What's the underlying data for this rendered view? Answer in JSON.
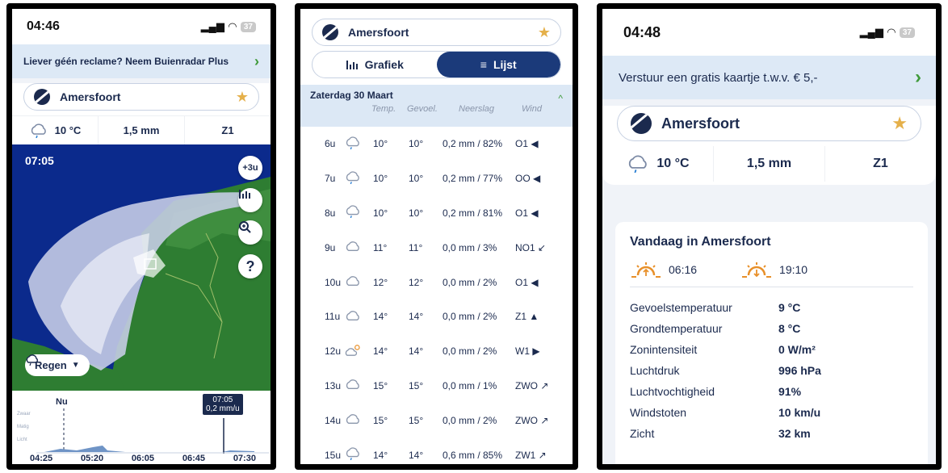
{
  "panel1": {
    "status_time": "04:46",
    "battery": "37",
    "promo_text": "Liever géén reclame? Neem Buienradar Plus",
    "location": "Amersfoort",
    "temp": "10 °C",
    "precip": "1,5 mm",
    "wind": "Z1",
    "map_time": "07:05",
    "btn_plus": "+3u",
    "btn_help": "?",
    "regen_label": "Regen",
    "tl_now": "Nu",
    "tl_tip_time": "07:05",
    "tl_tip_value": "0,2 mm/u",
    "tl_levels": [
      "Zwaar",
      "Matig",
      "Licht"
    ],
    "tl_times": [
      "04:25",
      "05:20",
      "06:05",
      "06:45",
      "07:30"
    ]
  },
  "panel2": {
    "location": "Amersfoort",
    "tab_chart": "Grafiek",
    "tab_list": "Lijst",
    "day_title": "Zaterdag 30 Maart",
    "col_temp": "Temp.",
    "col_feel": "Gevoel.",
    "col_precip": "Neerslag",
    "col_wind": "Wind",
    "rows": [
      {
        "hour": "6u",
        "temp": "10°",
        "feel": "10°",
        "precip": "0,2 mm / 82%",
        "wind": "O1 ◀",
        "icon": "rain-cloud"
      },
      {
        "hour": "7u",
        "temp": "10°",
        "feel": "10°",
        "precip": "0,2 mm / 77%",
        "wind": "OO ◀",
        "icon": "rain-cloud"
      },
      {
        "hour": "8u",
        "temp": "10°",
        "feel": "10°",
        "precip": "0,2 mm / 81%",
        "wind": "O1 ◀",
        "icon": "rain-cloud"
      },
      {
        "hour": "9u",
        "temp": "11°",
        "feel": "11°",
        "precip": "0,0 mm / 3%",
        "wind": "NO1 ↙",
        "icon": "cloud"
      },
      {
        "hour": "10u",
        "temp": "12°",
        "feel": "12°",
        "precip": "0,0 mm / 2%",
        "wind": "O1 ◀",
        "icon": "cloud"
      },
      {
        "hour": "11u",
        "temp": "14°",
        "feel": "14°",
        "precip": "0,0 mm / 2%",
        "wind": "Z1 ▲",
        "icon": "cloud"
      },
      {
        "hour": "12u",
        "temp": "14°",
        "feel": "14°",
        "precip": "0,0 mm / 2%",
        "wind": "W1 ▶",
        "icon": "sun-cloud"
      },
      {
        "hour": "13u",
        "temp": "15°",
        "feel": "15°",
        "precip": "0,0 mm / 1%",
        "wind": "ZWO ↗",
        "icon": "cloud"
      },
      {
        "hour": "14u",
        "temp": "15°",
        "feel": "15°",
        "precip": "0,0 mm / 2%",
        "wind": "ZWO ↗",
        "icon": "cloud"
      },
      {
        "hour": "15u",
        "temp": "14°",
        "feel": "14°",
        "precip": "0,6 mm / 85%",
        "wind": "ZW1 ↗",
        "icon": "rain-cloud"
      }
    ]
  },
  "panel3": {
    "status_time": "04:48",
    "battery": "37",
    "promo_text": "Verstuur een gratis kaartje t.w.v. € 5,-",
    "location": "Amersfoort",
    "temp": "10 °C",
    "precip": "1,5 mm",
    "wind": "Z1",
    "today_title": "Vandaag in Amersfoort",
    "sunrise": "06:16",
    "sunset": "19:10",
    "details": [
      {
        "label": "Gevoelstemperatuur",
        "value": "9 °C"
      },
      {
        "label": "Grondtemperatuur",
        "value": "8 °C"
      },
      {
        "label": "Zonintensiteit",
        "value": "0 W/m²"
      },
      {
        "label": "Luchtdruk",
        "value": "996 hPa"
      },
      {
        "label": "Luchtvochtigheid",
        "value": "91%"
      },
      {
        "label": "Windstoten",
        "value": "10 km/u"
      },
      {
        "label": "Zicht",
        "value": "32 km"
      }
    ]
  },
  "colors": {
    "navy": "#1b2a4e",
    "accent_green": "#3f9a3a",
    "star": "#e5b04a",
    "promo_bg": "#dde9f6"
  }
}
